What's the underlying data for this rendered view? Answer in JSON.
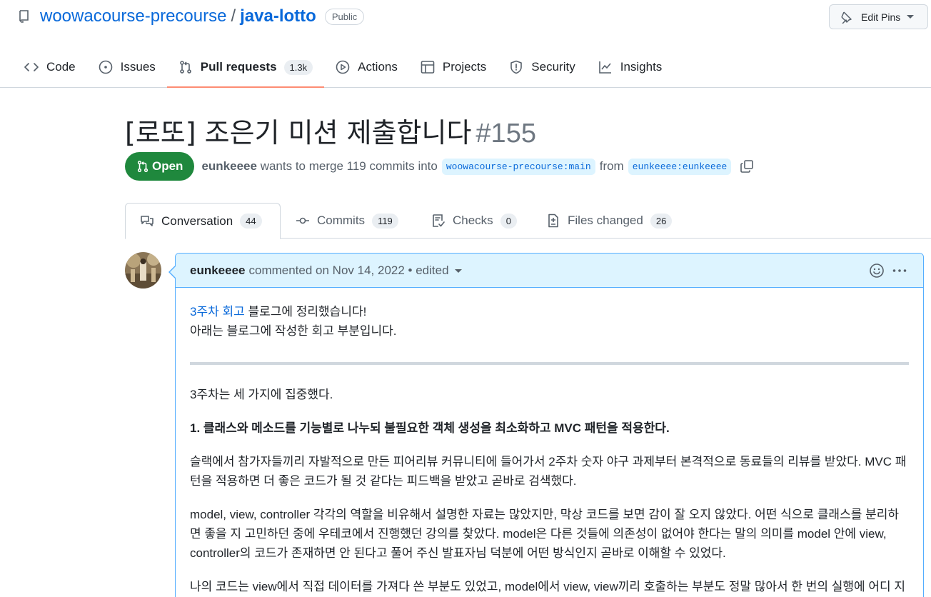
{
  "repo": {
    "owner": "woowacourse-precourse",
    "separator": "/",
    "name": "java-lotto",
    "visibility": "Public",
    "edit_pins_label": "Edit Pins"
  },
  "nav": [
    {
      "label": "Code",
      "icon": "code-icon"
    },
    {
      "label": "Issues",
      "icon": "issue-icon"
    },
    {
      "label": "Pull requests",
      "icon": "pull-request-icon",
      "counter": "1.3k",
      "active": true
    },
    {
      "label": "Actions",
      "icon": "play-icon"
    },
    {
      "label": "Projects",
      "icon": "table-icon"
    },
    {
      "label": "Security",
      "icon": "shield-icon"
    },
    {
      "label": "Insights",
      "icon": "graph-icon"
    }
  ],
  "pr": {
    "title": "[로또] 조은기 미션 제출합니다",
    "number": "#155",
    "state": "Open",
    "author": "eunkeeee",
    "merge_text": "wants to merge 119 commits into",
    "base_branch": "woowacourse-precourse:main",
    "from_text": "from",
    "head_branch": "eunkeeee:eunkeeee"
  },
  "tabs": [
    {
      "label": "Conversation",
      "counter": "44",
      "icon": "comment-discussion-icon",
      "active": true
    },
    {
      "label": "Commits",
      "counter": "119",
      "icon": "commit-icon"
    },
    {
      "label": "Checks",
      "counter": "0",
      "icon": "checklist-icon"
    },
    {
      "label": "Files changed",
      "counter": "26",
      "icon": "file-diff-icon"
    }
  ],
  "comment": {
    "author": "eunkeeee",
    "action": "commented on Nov 14, 2022",
    "edited": "• edited",
    "link_text": "3주차 회고",
    "line1_rest": " 블로그에 정리했습니다!",
    "line2": "아래는 블로그에 작성한 회고 부분입니다.",
    "p1": "3주차는 세 가지에 집중했다.",
    "h1": "1. 클래스와 메소드를 기능별로 나누되 불필요한 객체 생성을 최소화하고 MVC 패턴을 적용한다.",
    "p2": "슬랙에서 참가자들끼리 자발적으로 만든 피어리뷰 커뮤니티에 들어가서 2주차 숫자 야구 과제부터 본격적으로 동료들의 리뷰를 받았다. MVC 패턴을 적용하면 더 좋은 코드가 될 것 같다는 피드백을 받았고 곧바로 검색했다.",
    "p3": "model, view, controller 각각의 역할을 비유해서 설명한 자료는 많았지만, 막상 코드를 보면 감이 잘 오지 않았다. 어떤 식으로 클래스를 분리하면 좋을 지 고민하던 중에 우테코에서 진행했던 강의를 찾았다. model은 다른 것들에 의존성이 없어야 한다는 말의 의미를 model 안에 view, controller의 코드가 존재하면 안 된다고 풀어 주신 발표자님 덕분에 어떤 방식인지 곧바로 이해할 수 있었다.",
    "p4": "나의 코드는 view에서 직접 데이터를 가져다 쓴 부분도 있었고, model에서 view, view끼리 호출하는 부분도 정말 많아서 한 번의 실행에 어디 지역은 오지만 실행되고 있었던 view가 model의 데이터를 직접 가져다 쓰지 않도록 정리하는 VIEW에서 확수의 관리되는"
  },
  "colors": {
    "link": "#0969da",
    "open_green": "#1f883d",
    "tab_underline": "#fd8c73",
    "comment_header_bg": "#ddf4ff",
    "comment_border": "#54aeff"
  }
}
